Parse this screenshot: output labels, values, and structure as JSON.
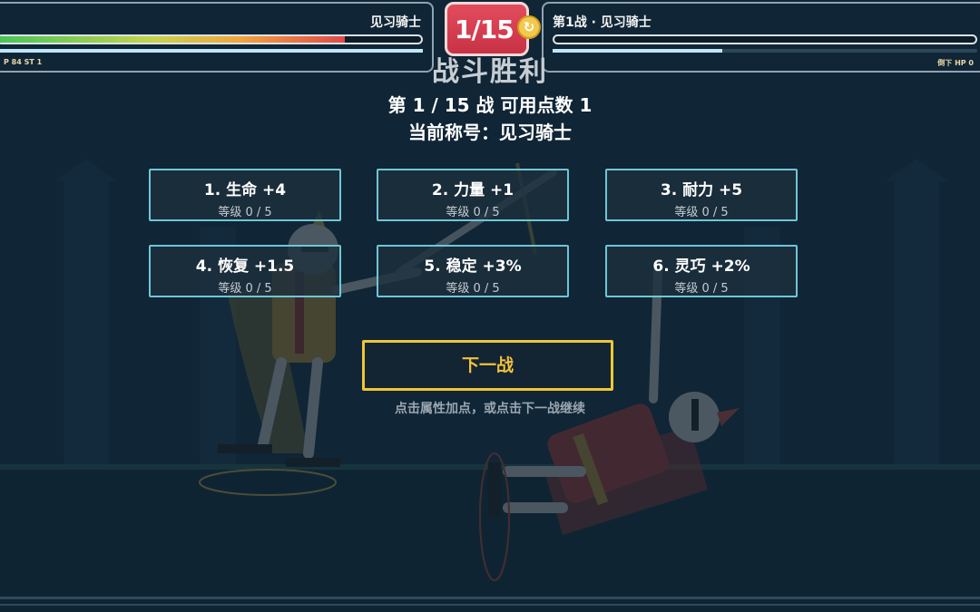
{
  "hud": {
    "player": {
      "name": "见习骑士",
      "hp_fraction": 0.82,
      "stamina_fraction": 1.0,
      "stats": "P 84 ST 1"
    },
    "round_badge": "1/15",
    "round_icon": "refresh-coin-icon",
    "enemy": {
      "name": "第1战 · 见习骑士",
      "hp_fraction": 0.0,
      "stamina_fraction": 0.4,
      "stats": "倒下 HP 0"
    }
  },
  "result": {
    "title": "战斗胜利",
    "battle_info": "第 1 / 15 战  可用点数 1",
    "current_title": "当前称号：见习骑士"
  },
  "upgrades": [
    {
      "label": "1. 生命 +4",
      "level": "等级 0 / 5"
    },
    {
      "label": "2. 力量 +1",
      "level": "等级 0 / 5"
    },
    {
      "label": "3. 耐力 +5",
      "level": "等级 0 / 5"
    },
    {
      "label": "4. 恢复 +1.5",
      "level": "等级 0 / 5"
    },
    {
      "label": "5. 稳定 +3%",
      "level": "等级 0 / 5"
    },
    {
      "label": "6. 灵巧 +2%",
      "level": "等级 0 / 5"
    }
  ],
  "next_button": "下一战",
  "hint": "点击属性加点，或点击下一战继续",
  "scene_labels": {
    "player_tag": "见习骑士",
    "enemy_tag": "第1战 · 见习骑士"
  },
  "colors": {
    "accent_gold": "#f0c636",
    "card_border": "#6fc6d6",
    "badge_red": "#d93d50"
  }
}
